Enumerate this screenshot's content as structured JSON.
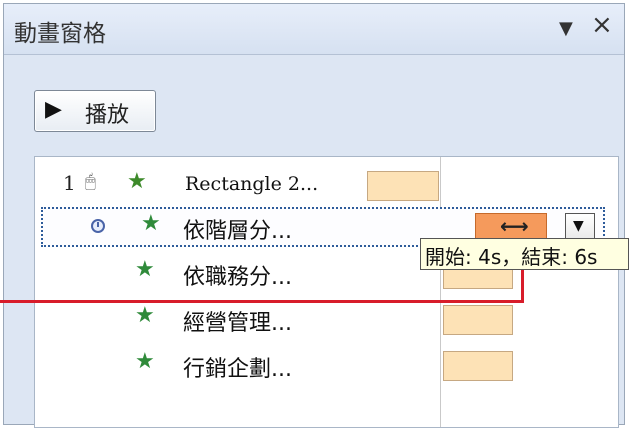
{
  "pane": {
    "title": "動畫窗格",
    "dropdown_icon": "▼",
    "close_icon": "×"
  },
  "play_button": {
    "icon": "▶",
    "label": "播放"
  },
  "animations": [
    {
      "number": "1",
      "trigger_icon": "mouse-click-icon",
      "effect_icon": "star-icon",
      "label": "Rectangle 2..."
    },
    {
      "number": "",
      "trigger_icon": "clock-icon",
      "effect_icon": "star-icon",
      "label": "依階層分...",
      "selected": true
    },
    {
      "number": "",
      "trigger_icon": "",
      "effect_icon": "star-icon",
      "label": "依職務分..."
    },
    {
      "number": "",
      "trigger_icon": "",
      "effect_icon": "star-icon",
      "label": "經營管理..."
    },
    {
      "number": "",
      "trigger_icon": "",
      "effect_icon": "star-icon",
      "label": "行銷企劃..."
    }
  ],
  "selected_row": {
    "resize_icon": "⟷",
    "dropdown_icon": "▼"
  },
  "tooltip": {
    "text": "開始: 4s，結束: 6s"
  },
  "colors": {
    "bar_fill": "#fde2b6",
    "bar_selected": "#f59a5c",
    "callout": "#d81c2a",
    "pane_bg": "#dde6f3"
  }
}
